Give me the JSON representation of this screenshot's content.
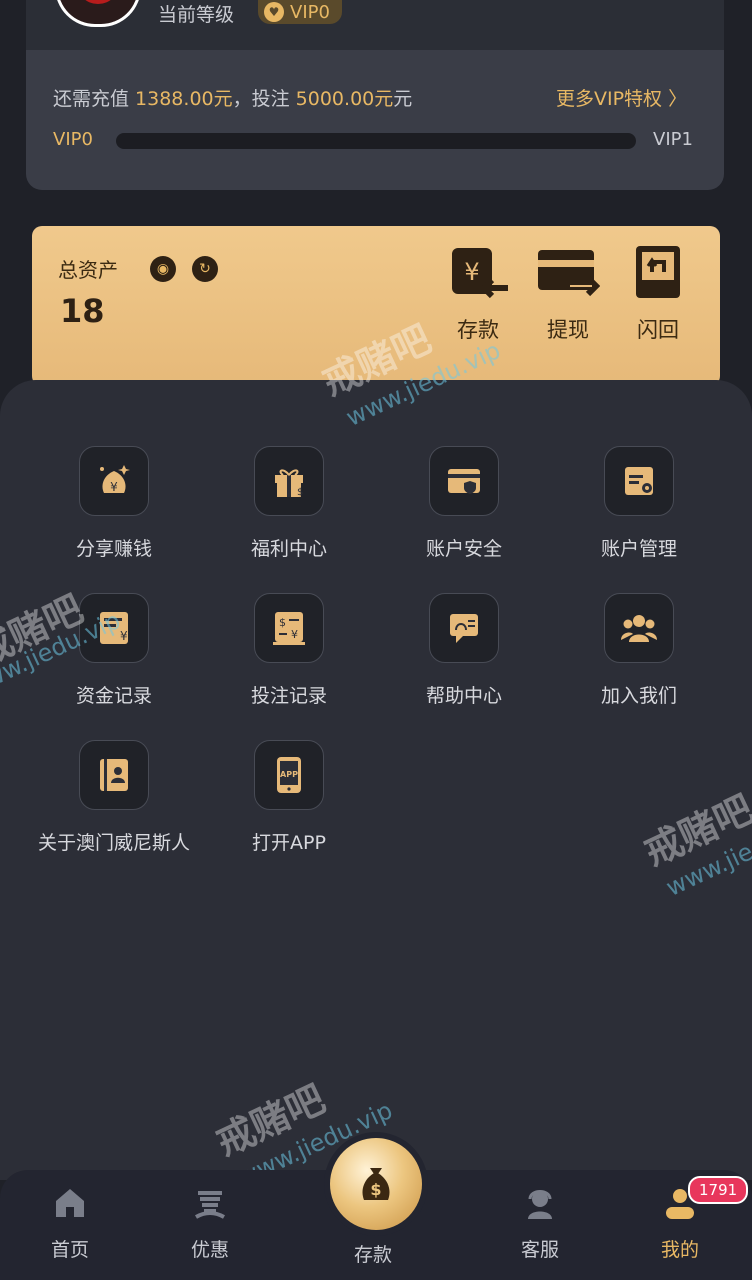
{
  "profile": {
    "level_label": "当前等级",
    "vip_level": "VIP0"
  },
  "vip_progress": {
    "recharge_prefix": "还需充值 ",
    "recharge_amount": "1388.00元",
    "middle_text": "元，投注 ",
    "bet_amount": "5000.00元",
    "suffix": "元",
    "more_link": "更多VIP特权 〉",
    "from_level": "VIP0",
    "to_level": "VIP1",
    "progress_fraction": 0
  },
  "assets": {
    "title": "总资产",
    "value": "18",
    "actions": [
      {
        "label": "存款",
        "icon": "deposit-icon"
      },
      {
        "label": "提现",
        "icon": "withdraw-icon"
      },
      {
        "label": "闪回",
        "icon": "flashback-icon"
      }
    ]
  },
  "menu": {
    "items": [
      {
        "label": "分享赚钱",
        "icon": "money-bag-share-icon"
      },
      {
        "label": "福利中心",
        "icon": "gift-icon"
      },
      {
        "label": "账户安全",
        "icon": "card-shield-icon"
      },
      {
        "label": "账户管理",
        "icon": "card-gear-icon"
      },
      {
        "label": "资金记录",
        "icon": "fund-record-icon"
      },
      {
        "label": "投注记录",
        "icon": "bet-record-icon"
      },
      {
        "label": "帮助中心",
        "icon": "help-chat-icon"
      },
      {
        "label": "加入我们",
        "icon": "group-icon"
      },
      {
        "label": "关于澳门威尼斯人",
        "icon": "about-book-icon"
      },
      {
        "label": "打开APP",
        "icon": "app-phone-icon"
      }
    ]
  },
  "nav": {
    "home": "首页",
    "promo": "优惠",
    "deposit": "存款",
    "service": "客服",
    "mine": "我的",
    "badge_count": "1791"
  },
  "colors": {
    "accent": "#e8b864",
    "panel": "#2c2e37",
    "background": "#1f2128"
  },
  "watermark": {
    "text": "戒赌吧",
    "url": "www.jiedu.vip"
  }
}
